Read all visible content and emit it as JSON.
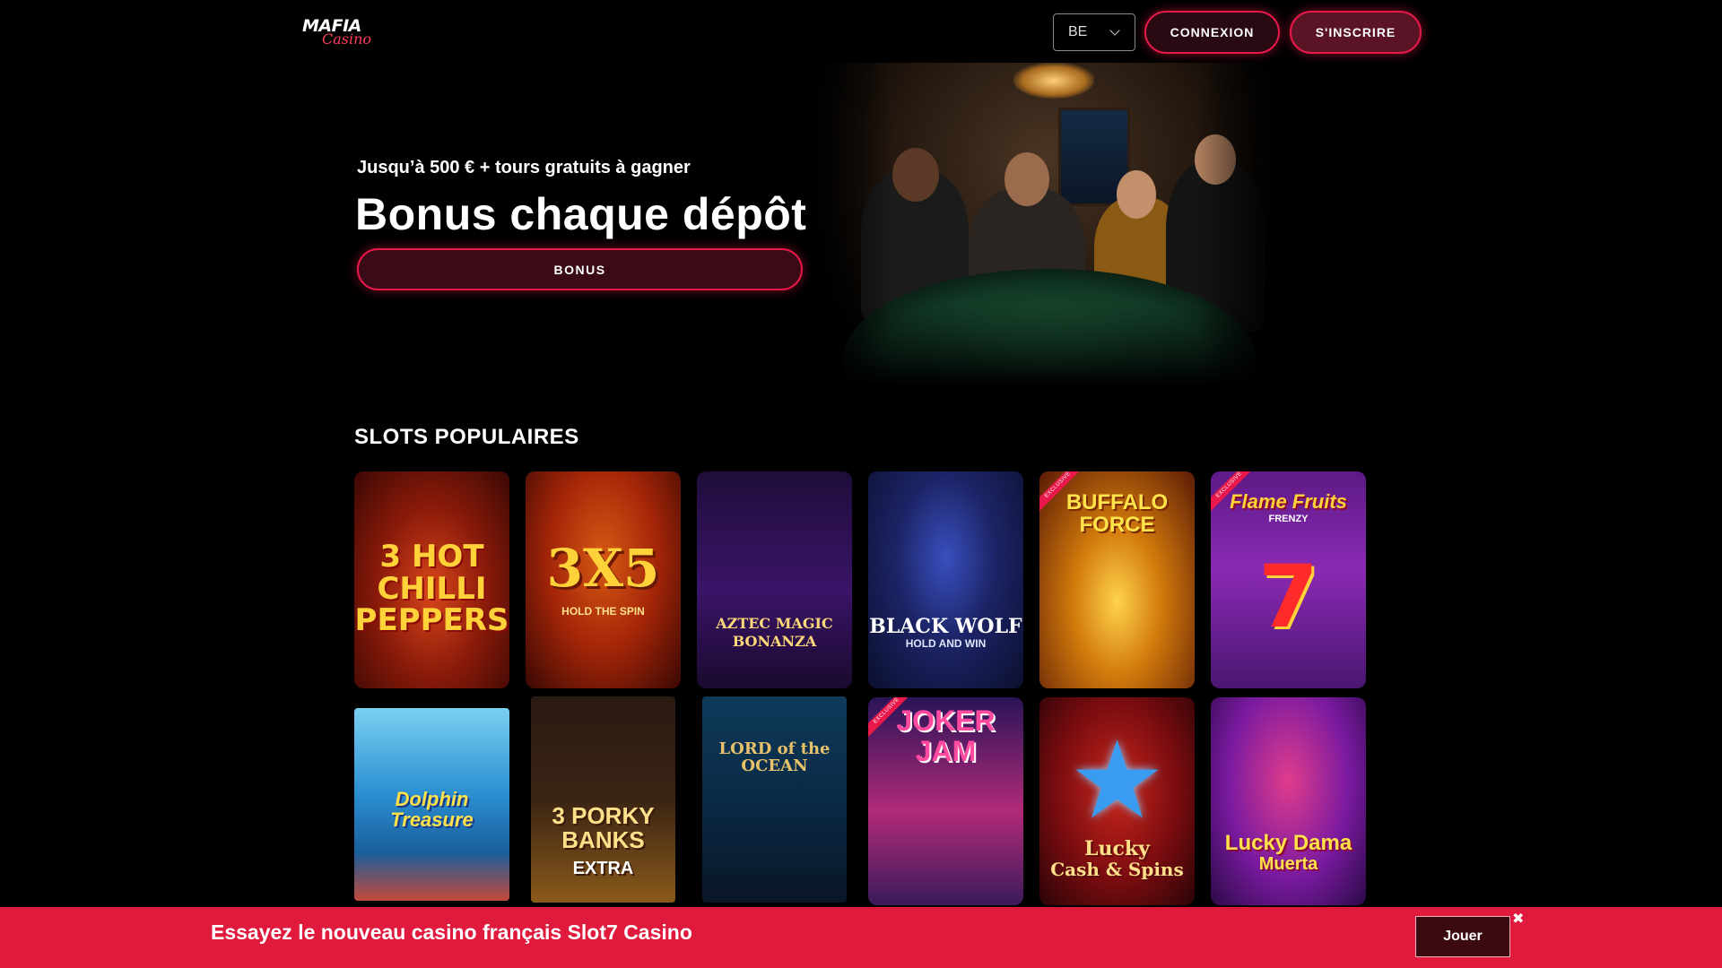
{
  "header": {
    "logo_line1": "MAFIA",
    "logo_line2": "Casino",
    "lang_selected": "BE",
    "login_label": "CONNEXION",
    "signup_label": "S'INSCRIRE"
  },
  "hero": {
    "subtitle": "Jusqu’à 500 € + tours gratuits à gagner",
    "title": "Bonus chaque dépôt",
    "cta_label": "BONUS"
  },
  "section": {
    "title": "SLOTS POPULAIRES",
    "exclusive_ribbon": "EXCLUSIVE",
    "games": [
      {
        "name": "3 HOT CHILLI PEPPERS",
        "exclusive": false
      },
      {
        "name": "3X5",
        "sub": "HOLD THE SPIN",
        "exclusive": false
      },
      {
        "name": "AZTEC MAGIC",
        "sub": "BONANZA",
        "exclusive": false
      },
      {
        "name": "BLACK WOLF",
        "sub": "HOLD AND WIN",
        "exclusive": false
      },
      {
        "name": "BUFFALO FORCE",
        "exclusive": true
      },
      {
        "name": "Flame Fruits",
        "sub": "FRENZY",
        "exclusive": true
      },
      {
        "name": "Dolphin Treasure",
        "exclusive": false
      },
      {
        "name": "3 PORKY BANKS",
        "sub": "EXTRA",
        "exclusive": false
      },
      {
        "name": "LORD of the OCEAN",
        "exclusive": false
      },
      {
        "name": "JOKER JAM",
        "exclusive": true
      },
      {
        "name": "Lucky",
        "sub": "Cash & Spins",
        "exclusive": false
      },
      {
        "name": "Lucky Dama",
        "sub": "Muerta",
        "exclusive": false
      }
    ]
  },
  "promo": {
    "text": "Essayez le nouveau casino français Slot7 Casino",
    "play_label": "Jouer",
    "close_glyph": "✖"
  },
  "colors": {
    "accent": "#e8184a",
    "promo_bar": "#e01a3c",
    "background": "#000000"
  }
}
